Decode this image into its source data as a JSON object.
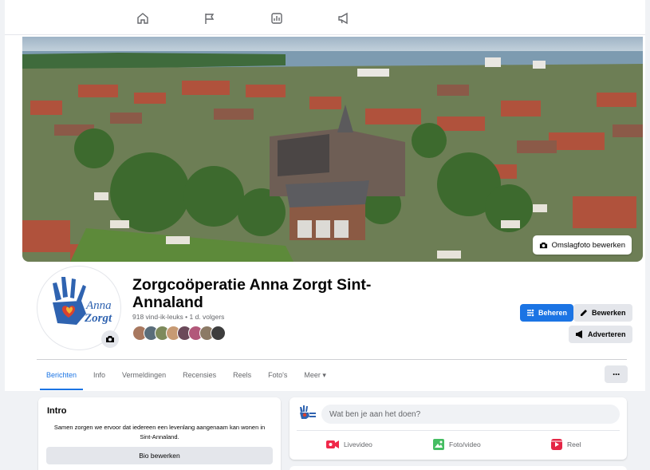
{
  "nav": {
    "icons": [
      "home-icon",
      "flag-icon",
      "ad-center-icon",
      "megaphone-icon"
    ]
  },
  "cover": {
    "edit_button_label": "Omslagfoto bewerken"
  },
  "page": {
    "name": "Zorgcoöperatie Anna Zorgt Sint-Annaland",
    "stats": "918 vind-ik-leuks • 1 d. volgers",
    "logo_text_line1": "Anna",
    "logo_text_line2": "Zorgt",
    "follower_count_shown": 8
  },
  "actions": {
    "manage_label": "Beheren",
    "edit_label": "Bewerken",
    "advertise_label": "Adverteren"
  },
  "tabs": [
    {
      "label": "Berichten",
      "active": true
    },
    {
      "label": "Info",
      "active": false
    },
    {
      "label": "Vermeldingen",
      "active": false
    },
    {
      "label": "Recensies",
      "active": false
    },
    {
      "label": "Reels",
      "active": false
    },
    {
      "label": "Foto's",
      "active": false
    },
    {
      "label": "Meer ▾",
      "active": false
    }
  ],
  "more_label": "···",
  "intro": {
    "title": "Intro",
    "text": "Samen zorgen we ervoor dat iedereen een levenlang aangenaam kan wonen in Sint-Annaland.",
    "bio_button_label": "Bio bewerken"
  },
  "composer": {
    "placeholder": "Wat ben je aan het doen?",
    "actions": [
      {
        "label": "Livevideo",
        "icon": "live-video-icon",
        "color": "#f02849"
      },
      {
        "label": "Foto/video",
        "icon": "photo-icon",
        "color": "#45bd62"
      },
      {
        "label": "Reel",
        "icon": "reel-icon",
        "color": "#e42645"
      }
    ]
  },
  "colors": {
    "accent": "#1b74e4",
    "background": "#f0f2f5",
    "secondary_button": "#e4e6eb"
  }
}
